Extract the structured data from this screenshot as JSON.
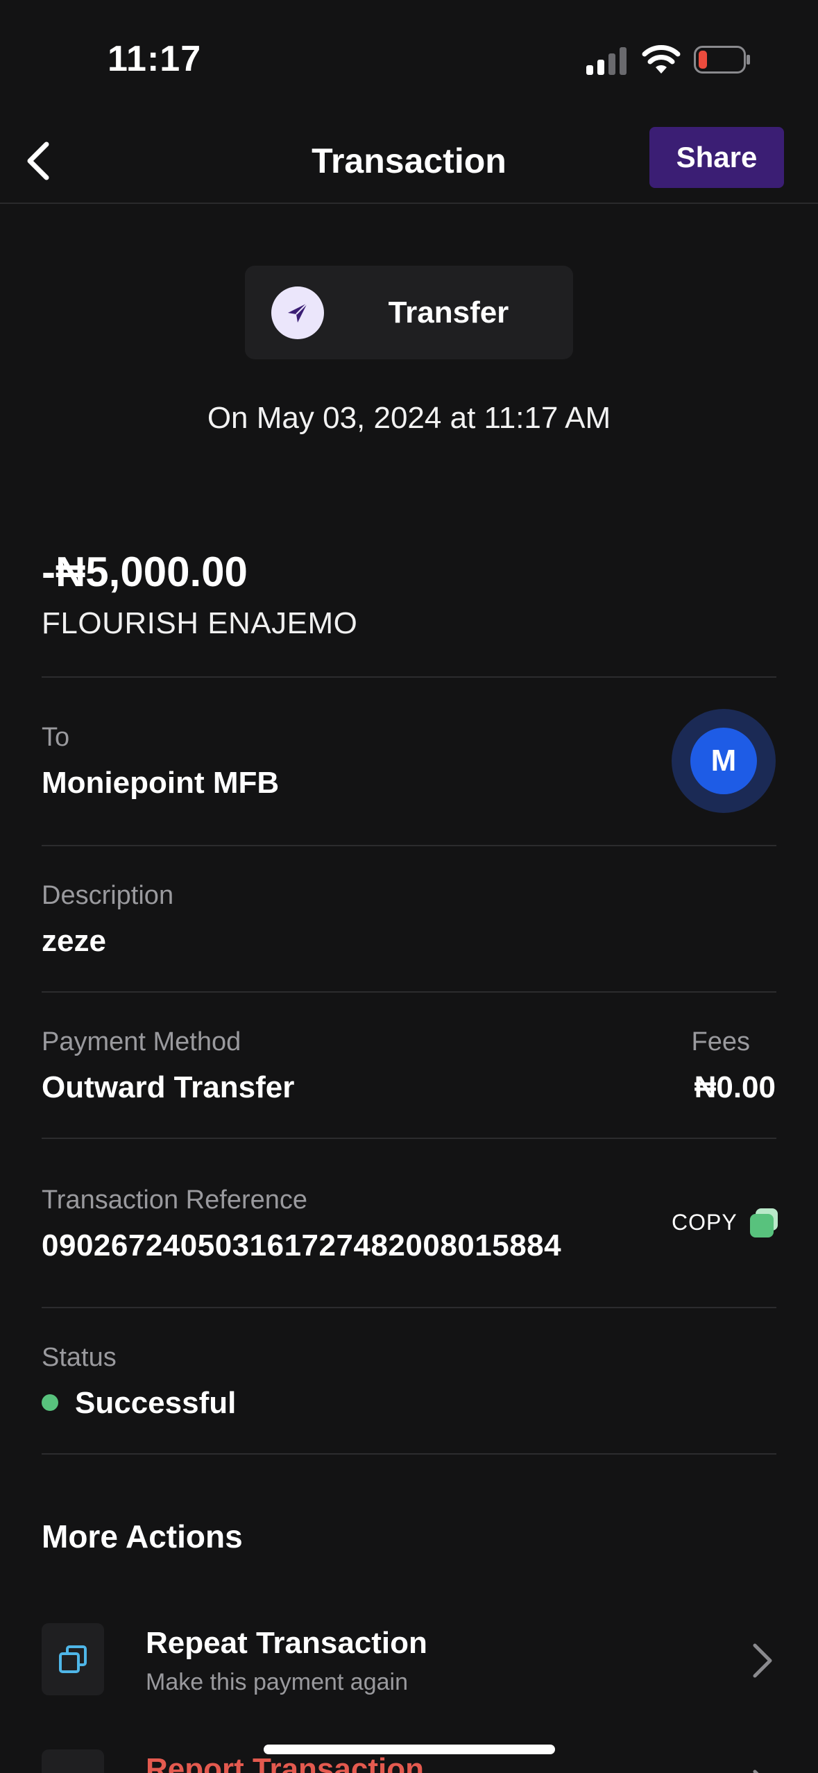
{
  "status_bar": {
    "time": "11:17"
  },
  "nav": {
    "title": "Transaction",
    "share_label": "Share"
  },
  "transaction": {
    "type_label": "Transfer",
    "date": "On May 03, 2024 at 11:17 AM",
    "amount": "-₦5,000.00",
    "counterparty": "FLOURISH ENAJEMO"
  },
  "details": {
    "to_label": "To",
    "to_value": "Moniepoint MFB",
    "bank_initial": "M",
    "description_label": "Description",
    "description_value": "zeze",
    "payment_method_label": "Payment Method",
    "payment_method_value": "Outward Transfer",
    "fees_label": "Fees",
    "fees_value": "₦0.00",
    "reference_label": "Transaction Reference",
    "reference_value": "090267240503161727482008015884",
    "copy_label": "COPY",
    "status_label": "Status",
    "status_value": "Successful"
  },
  "more_actions": {
    "title": "More Actions",
    "items": [
      {
        "title": "Repeat Transaction",
        "subtitle": "Make this payment again"
      },
      {
        "title": "Report Transaction",
        "subtitle": ""
      }
    ]
  },
  "colors": {
    "background": "#131314",
    "share_button": "#3b1e74",
    "status_success": "#58c27d",
    "report_red": "#e45a4f",
    "copy_green": "#58c27d",
    "bank_blue": "#1e5ce6"
  },
  "icons": {
    "back": "chevron-left-icon",
    "transfer": "paper-plane-icon",
    "copy": "copy-icon",
    "repeat": "duplicate-icon",
    "report": "flag-icon",
    "chevron": "chevron-right-icon"
  }
}
